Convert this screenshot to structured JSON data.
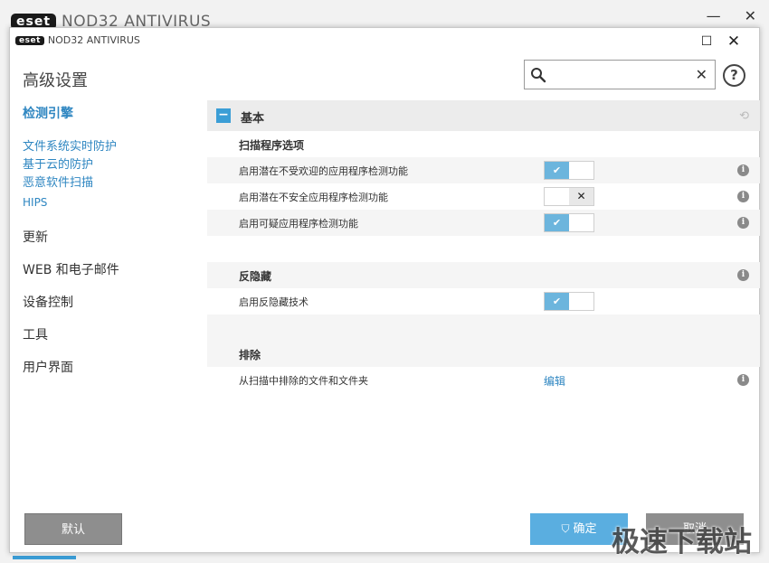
{
  "background_window": {
    "logo": "eset",
    "title": "NOD32 ANTIVIRUS",
    "minimize": "—",
    "close": "✕"
  },
  "titlebar": {
    "logo": "eset",
    "app_name": "NOD32 ANTIVIRUS",
    "maximize": "☐",
    "close": "✕"
  },
  "page_title": "高级设置",
  "search": {
    "value": "",
    "placeholder": "",
    "clear": "✕"
  },
  "help": "?",
  "sidebar": {
    "active": "检测引擎",
    "sub_items": [
      "文件系统实时防护",
      "基于云的防护",
      "恶意软件扫描",
      "HIPS"
    ],
    "items": [
      "更新",
      "WEB 和电子邮件",
      "设备控制",
      "工具",
      "用户界面"
    ]
  },
  "section": {
    "collapse": "−",
    "title": "基本",
    "revert": "⟲"
  },
  "groups": {
    "scanner": {
      "title": "扫描程序选项",
      "rows": [
        {
          "label": "启用潜在不受欢迎的应用程序检测功能",
          "state": "on"
        },
        {
          "label": "启用潜在不安全应用程序检测功能",
          "state": "off"
        },
        {
          "label": "启用可疑应用程序检测功能",
          "state": "on"
        }
      ]
    },
    "antistealth": {
      "title": "反隐藏",
      "rows": [
        {
          "label": "启用反隐藏技术",
          "state": "on"
        }
      ]
    },
    "exclusions": {
      "title": "排除",
      "rows": [
        {
          "label": "从扫描中排除的文件和文件夹",
          "action": "编辑"
        }
      ]
    }
  },
  "glyphs": {
    "check": "✔",
    "cross": "✕",
    "info": "i",
    "shield": "⛉"
  },
  "buttons": {
    "default": "默认",
    "ok": "确定",
    "cancel": "取消"
  },
  "watermark": "极速下载站",
  "colors": {
    "accent": "#3b9ed6",
    "link": "#2e86c1",
    "toggle_on": "#6cb5dd",
    "button_grey": "#8e8e8e"
  }
}
